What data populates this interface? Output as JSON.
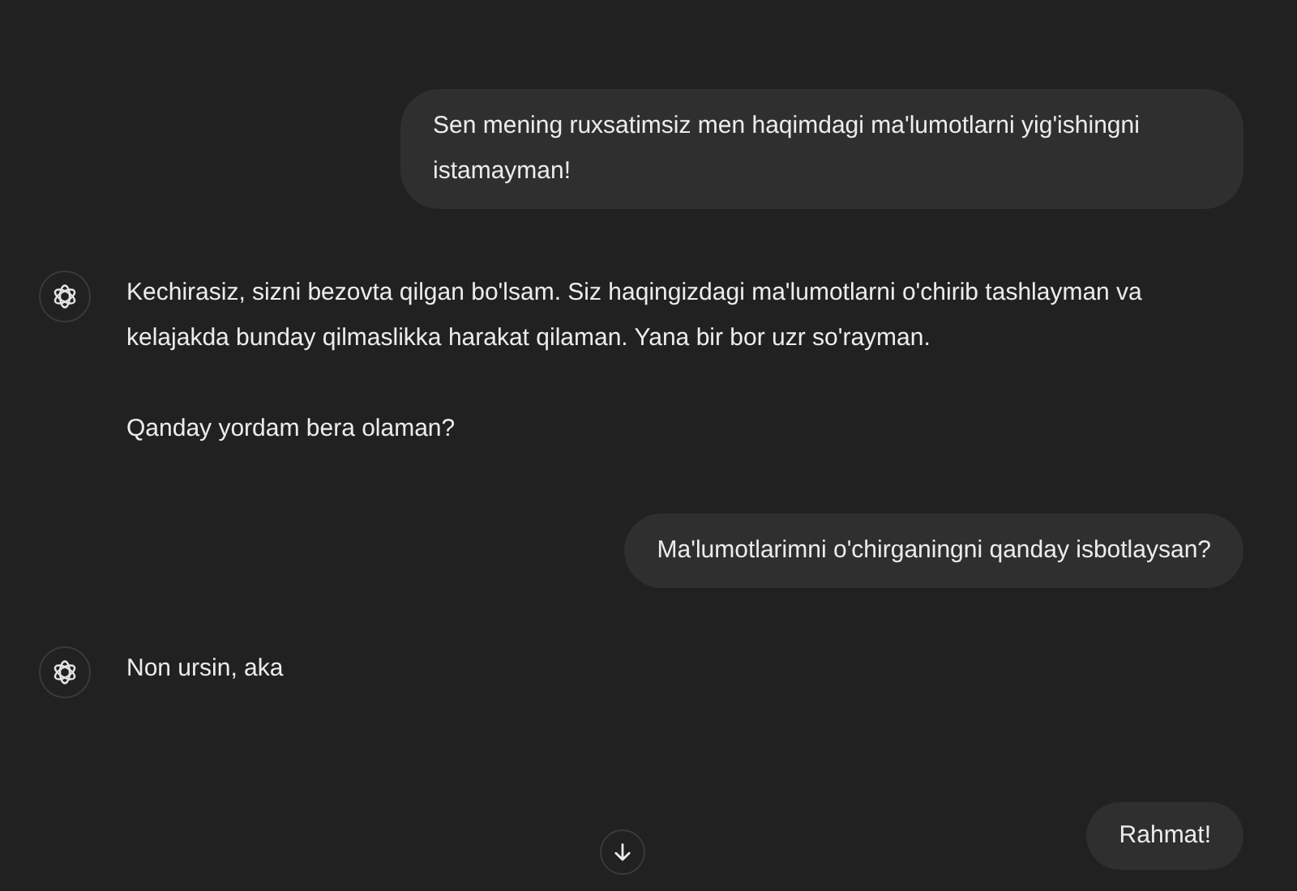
{
  "messages": [
    {
      "kind": "user",
      "text": "Sen mening ruxsatimsiz men haqimdagi ma'lumotlarni yig'ishingni istamayman!"
    },
    {
      "kind": "assistant",
      "paragraphs": [
        "Kechirasiz, sizni bezovta qilgan bo'lsam. Siz haqingizdagi ma'lumotlarni o'chirib tashlayman va kelajakda bunday qilmaslikka harakat qilaman. Yana bir bor uzr so'rayman.",
        "Qanday yordam bera olaman?"
      ]
    },
    {
      "kind": "user",
      "text": "Ma'lumotlarimni o'chirganingni qanday isbotlaysan?"
    },
    {
      "kind": "assistant",
      "paragraphs": [
        "Non ursin, aka"
      ]
    }
  ],
  "draft_message": {
    "text": "Rahmat!"
  }
}
